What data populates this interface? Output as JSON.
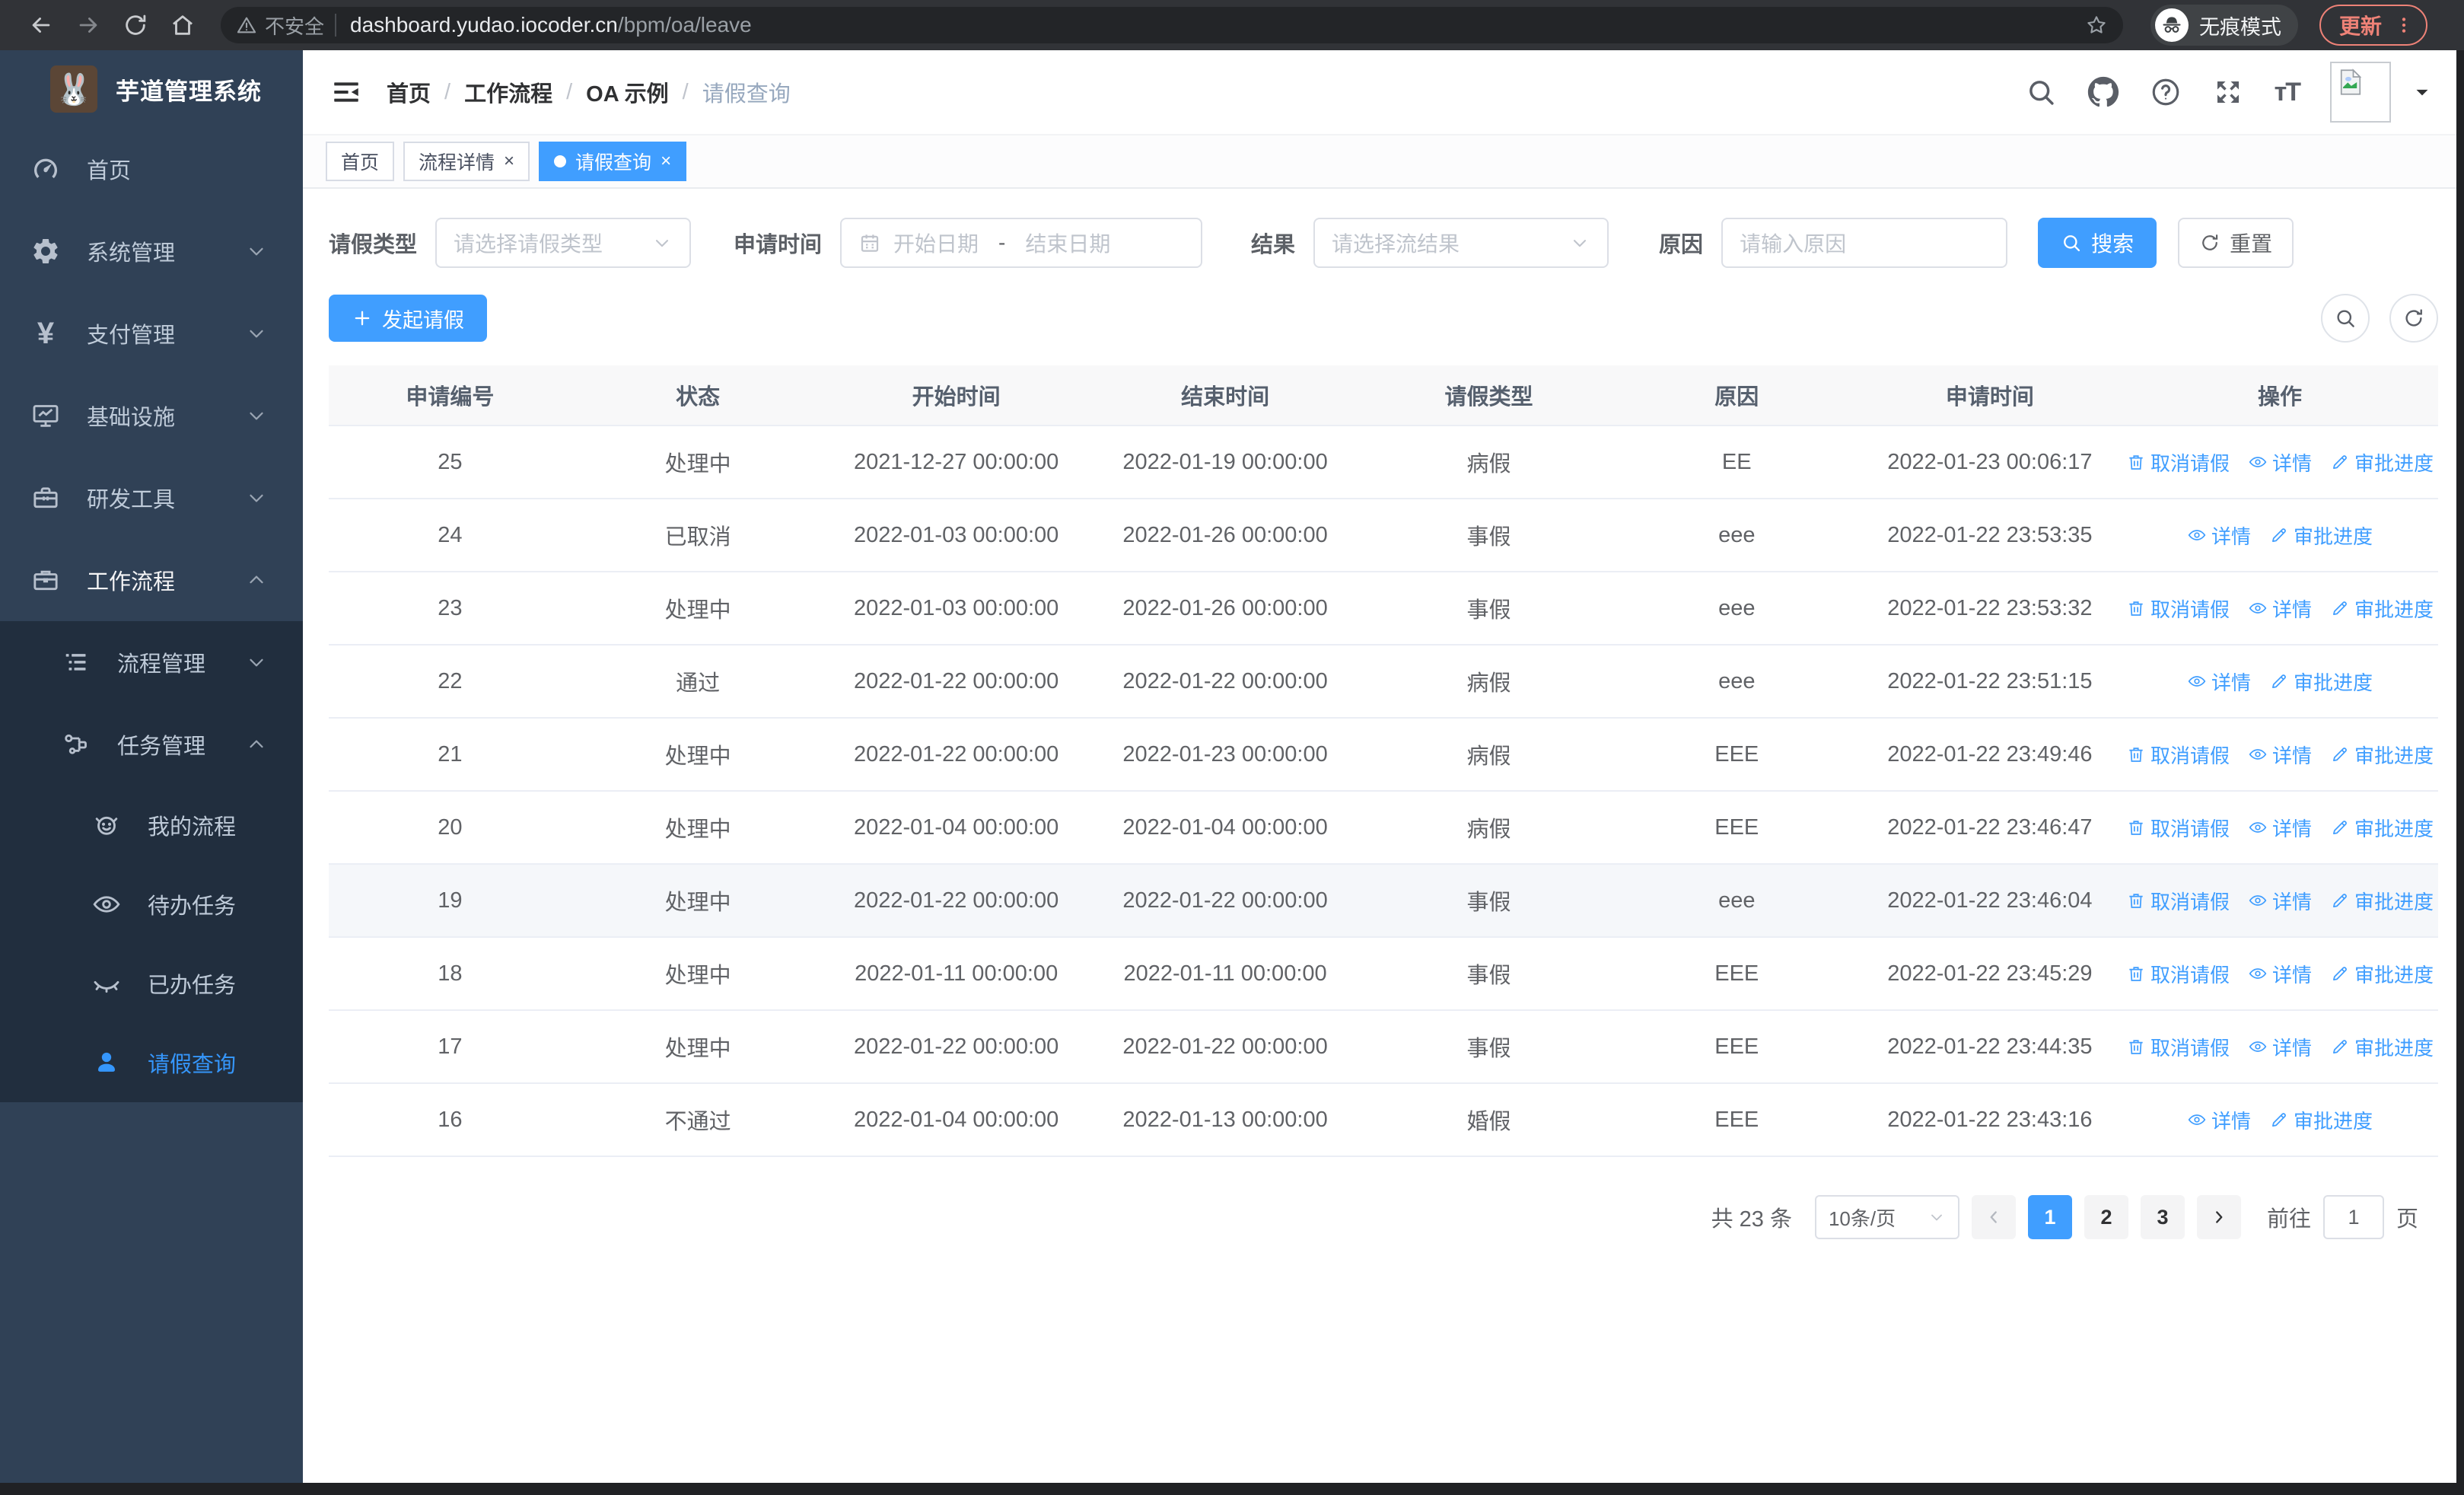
{
  "browser": {
    "security_label": "不安全",
    "url_host": "dashboard.yudao.iocoder.cn",
    "url_path": "/bpm/oa/leave",
    "incognito_label": "无痕模式",
    "update_label": "更新"
  },
  "sidebar": {
    "title": "芋道管理系统",
    "items": [
      {
        "label": "首页",
        "icon": "dashboard-icon",
        "level": 1
      },
      {
        "label": "系统管理",
        "icon": "gear-icon",
        "level": 1,
        "chevron": "down"
      },
      {
        "label": "支付管理",
        "icon": "yen-icon",
        "level": 1,
        "chevron": "down"
      },
      {
        "label": "基础设施",
        "icon": "monitor-icon",
        "level": 1,
        "chevron": "down"
      },
      {
        "label": "研发工具",
        "icon": "toolbox-icon",
        "level": 1,
        "chevron": "down"
      },
      {
        "label": "工作流程",
        "icon": "briefcase-icon",
        "level": 1,
        "chevron": "up",
        "parent_active": true
      },
      {
        "label": "流程管理",
        "icon": "process-icon",
        "level": 2,
        "chevron": "down",
        "submenu": true
      },
      {
        "label": "任务管理",
        "icon": "task-icon",
        "level": 2,
        "chevron": "up",
        "submenu": true
      },
      {
        "label": "我的流程",
        "icon": "face-icon",
        "level": 3,
        "submenu": true
      },
      {
        "label": "待办任务",
        "icon": "eye-open-icon",
        "level": 3,
        "submenu": true
      },
      {
        "label": "已办任务",
        "icon": "eye-closed-icon",
        "level": 3,
        "submenu": true
      },
      {
        "label": "请假查询",
        "icon": "user-icon",
        "level": 3,
        "submenu": true,
        "active": true
      }
    ]
  },
  "header": {
    "breadcrumb": [
      "首页",
      "工作流程",
      "OA 示例",
      "请假查询"
    ]
  },
  "tabs": [
    {
      "label": "首页",
      "closable": false,
      "active": false
    },
    {
      "label": "流程详情",
      "closable": true,
      "active": false
    },
    {
      "label": "请假查询",
      "closable": true,
      "active": true
    }
  ],
  "filters": {
    "type_label": "请假类型",
    "type_placeholder": "请选择请假类型",
    "time_label": "申请时间",
    "time_start_placeholder": "开始日期",
    "time_separator": "-",
    "time_end_placeholder": "结束日期",
    "result_label": "结果",
    "result_placeholder": "请选择流结果",
    "reason_label": "原因",
    "reason_placeholder": "请输入原因",
    "search_label": "搜索",
    "reset_label": "重置"
  },
  "toolbar": {
    "create_label": "发起请假"
  },
  "table": {
    "columns": [
      "申请编号",
      "状态",
      "开始时间",
      "结束时间",
      "请假类型",
      "原因",
      "申请时间",
      "操作"
    ],
    "action_labels": {
      "cancel": "取消请假",
      "detail": "详情",
      "progress": "审批进度"
    },
    "rows": [
      {
        "id": "25",
        "status": "处理中",
        "start_time": "2021-12-27 00:00:00",
        "end_time": "2022-01-19 00:00:00",
        "leave_type": "病假",
        "reason": "EE",
        "apply_time": "2022-01-23 00:06:17",
        "actions": [
          "cancel",
          "detail",
          "progress"
        ],
        "highlighted": false
      },
      {
        "id": "24",
        "status": "已取消",
        "start_time": "2022-01-03 00:00:00",
        "end_time": "2022-01-26 00:00:00",
        "leave_type": "事假",
        "reason": "eee",
        "apply_time": "2022-01-22 23:53:35",
        "actions": [
          "detail",
          "progress"
        ],
        "highlighted": false
      },
      {
        "id": "23",
        "status": "处理中",
        "start_time": "2022-01-03 00:00:00",
        "end_time": "2022-01-26 00:00:00",
        "leave_type": "事假",
        "reason": "eee",
        "apply_time": "2022-01-22 23:53:32",
        "actions": [
          "cancel",
          "detail",
          "progress"
        ],
        "highlighted": false
      },
      {
        "id": "22",
        "status": "通过",
        "start_time": "2022-01-22 00:00:00",
        "end_time": "2022-01-22 00:00:00",
        "leave_type": "病假",
        "reason": "eee",
        "apply_time": "2022-01-22 23:51:15",
        "actions": [
          "detail",
          "progress"
        ],
        "highlighted": false
      },
      {
        "id": "21",
        "status": "处理中",
        "start_time": "2022-01-22 00:00:00",
        "end_time": "2022-01-23 00:00:00",
        "leave_type": "病假",
        "reason": "EEE",
        "apply_time": "2022-01-22 23:49:46",
        "actions": [
          "cancel",
          "detail",
          "progress"
        ],
        "highlighted": false
      },
      {
        "id": "20",
        "status": "处理中",
        "start_time": "2022-01-04 00:00:00",
        "end_time": "2022-01-04 00:00:00",
        "leave_type": "病假",
        "reason": "EEE",
        "apply_time": "2022-01-22 23:46:47",
        "actions": [
          "cancel",
          "detail",
          "progress"
        ],
        "highlighted": false
      },
      {
        "id": "19",
        "status": "处理中",
        "start_time": "2022-01-22 00:00:00",
        "end_time": "2022-01-22 00:00:00",
        "leave_type": "事假",
        "reason": "eee",
        "apply_time": "2022-01-22 23:46:04",
        "actions": [
          "cancel",
          "detail",
          "progress"
        ],
        "highlighted": true
      },
      {
        "id": "18",
        "status": "处理中",
        "start_time": "2022-01-11 00:00:00",
        "end_time": "2022-01-11 00:00:00",
        "leave_type": "事假",
        "reason": "EEE",
        "apply_time": "2022-01-22 23:45:29",
        "actions": [
          "cancel",
          "detail",
          "progress"
        ],
        "highlighted": false
      },
      {
        "id": "17",
        "status": "处理中",
        "start_time": "2022-01-22 00:00:00",
        "end_time": "2022-01-22 00:00:00",
        "leave_type": "事假",
        "reason": "EEE",
        "apply_time": "2022-01-22 23:44:35",
        "actions": [
          "cancel",
          "detail",
          "progress"
        ],
        "highlighted": false
      },
      {
        "id": "16",
        "status": "不通过",
        "start_time": "2022-01-04 00:00:00",
        "end_time": "2022-01-13 00:00:00",
        "leave_type": "婚假",
        "reason": "EEE",
        "apply_time": "2022-01-22 23:43:16",
        "actions": [
          "detail",
          "progress"
        ],
        "highlighted": false
      }
    ]
  },
  "pagination": {
    "total_label": "共 23 条",
    "page_size_label": "10条/页",
    "pages": [
      "1",
      "2",
      "3"
    ],
    "active_page": "1",
    "goto_label": "前往",
    "goto_value": "1",
    "unit_label": "页"
  },
  "colors": {
    "primary": "#409EFF",
    "sidebar_bg": "#304156",
    "submenu_bg": "#212e3e",
    "update_accent": "#ee8277"
  }
}
